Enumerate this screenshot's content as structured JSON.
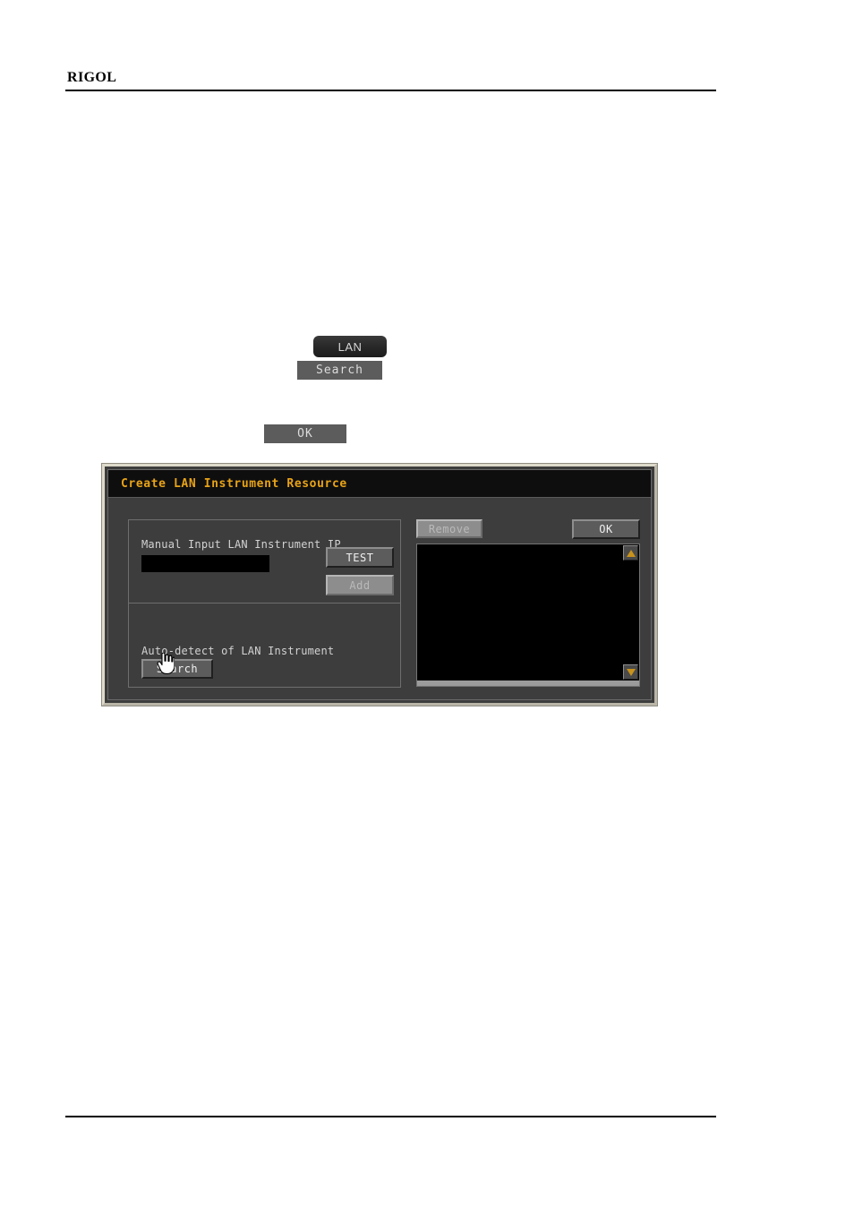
{
  "page": {
    "brand": "RIGOL"
  },
  "inline_keys": {
    "lan": "LAN",
    "search": "Search",
    "ok": "OK"
  },
  "dialog": {
    "title": "Create LAN Instrument Resource",
    "manual_group": {
      "label": "Manual Input LAN Instrument IP",
      "ip_value": "",
      "ip_placeholder": "",
      "test_label": "TEST",
      "add_label": "Add"
    },
    "auto_group": {
      "label": "Auto-detect of LAN Instrument",
      "search_label": "Search"
    },
    "resource_panel": {
      "remove_label": "Remove",
      "ok_label": "OK",
      "list_items": []
    },
    "colors": {
      "title_text": "#e8a317",
      "dialog_bg": "#3d3d3d",
      "titlebar_bg": "#0e0e0e",
      "outer_border": "#dedacb",
      "scroll_arrow": "#c8921c",
      "list_bg": "#000000"
    }
  }
}
